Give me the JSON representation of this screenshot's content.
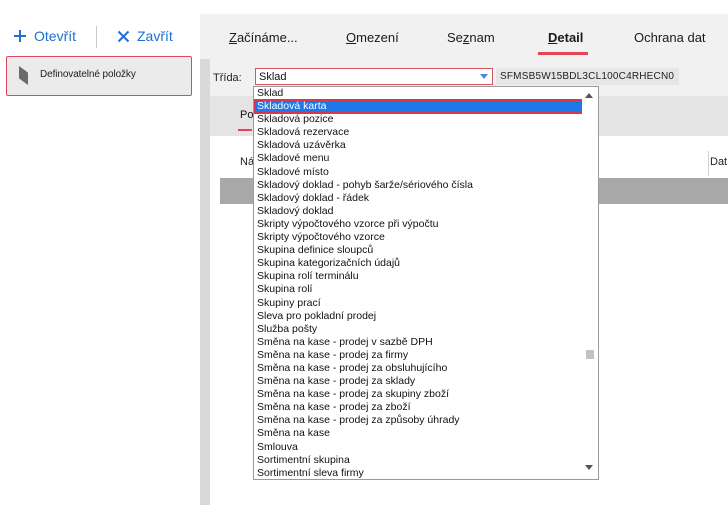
{
  "toolbar": {
    "open_label": "Otevřít",
    "close_label": "Zavřít"
  },
  "sidebar": {
    "panel_label": "Definovatelné položky"
  },
  "tabs": [
    {
      "label": "Začínáme...",
      "active": false
    },
    {
      "label": "Omezení",
      "active": false
    },
    {
      "label": "Seznam",
      "active": false
    },
    {
      "label": "Detail",
      "active": true
    },
    {
      "label": "Ochrana dat",
      "active": false
    }
  ],
  "form": {
    "trida_label": "Třída:",
    "trida_value": "Sklad",
    "class_code": "SFMSB5W15BDL3CL100C4RHECN0"
  },
  "subtabs": {
    "first_label": "Po"
  },
  "grid": {
    "col_n_header": "Ná",
    "col_d_header": "Dat"
  },
  "dropdown": {
    "selected_index": 1,
    "items": [
      "Sklad",
      "Skladová karta",
      "Skladová pozice",
      "Skladová rezervace",
      "Skladová uzávěrka",
      "Skladové menu",
      "Skladové místo",
      "Skladový doklad - pohyb šarže/sériového čísla",
      "Skladový doklad - řádek",
      "Skladový doklad",
      "Skripty výpočtového vzorce při výpočtu",
      "Skripty výpočtového vzorce",
      "Skupina definice sloupců",
      "Skupina kategorizačních údajů",
      "Skupina rolí terminálu",
      "Skupina rolí",
      "Skupiny prací",
      "Sleva pro pokladní prodej",
      "Služba pošty",
      "Směna na kase - prodej v sazbě DPH",
      "Směna na kase - prodej za firmy",
      "Směna na kase - prodej za obsluhujícího",
      "Směna na kase - prodej za sklady",
      "Směna na kase - prodej za skupiny zboží",
      "Směna na kase - prodej za zboží",
      "Směna na kase - prodej za způsoby úhrady",
      "Směna na kase",
      "Smlouva",
      "Sortimentní skupina",
      "Sortimentní sleva firmy"
    ]
  },
  "colors": {
    "accent": "#1e6fd1",
    "highlight_red": "#e34555",
    "selection_blue": "#1e78e6"
  }
}
